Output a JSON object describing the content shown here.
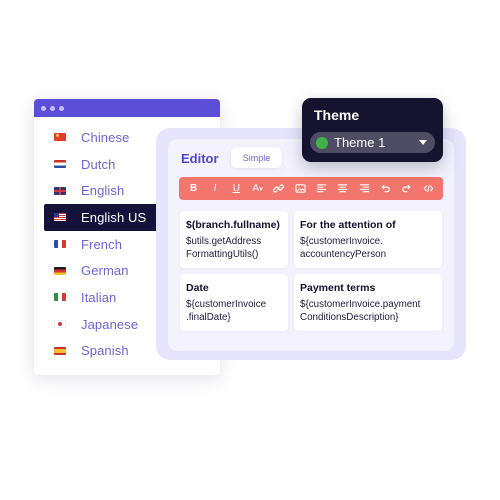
{
  "languages": {
    "items": [
      {
        "label": "Chinese",
        "flag": "flag-china"
      },
      {
        "label": "Dutch",
        "flag": "flag-netherlands"
      },
      {
        "label": "English",
        "flag": "flag-uk"
      },
      {
        "label": "English US",
        "flag": "flag-usa",
        "selected": true
      },
      {
        "label": "French",
        "flag": "flag-france"
      },
      {
        "label": "German",
        "flag": "flag-germany"
      },
      {
        "label": "Italian",
        "flag": "flag-italy"
      },
      {
        "label": "Japanese",
        "flag": "flag-japan"
      },
      {
        "label": "Spanish",
        "flag": "flag-spain"
      }
    ],
    "accent": "#5a4fd6",
    "selected_bg": "#14123a"
  },
  "editor": {
    "title": "Editor",
    "mode_tab": "Simple",
    "toolbar_color": "#f2766e",
    "toolbar": {
      "bold": "B",
      "italic": "I",
      "underline": "U",
      "font_size": "A",
      "font_size_mark": "▾"
    },
    "cells": [
      {
        "title": "$(branch.fullname)",
        "value": "$utils.getAddress FormattingUtils()"
      },
      {
        "title": "For the attention of",
        "value": "${customerInvoice. accountencyPerson"
      },
      {
        "title": "Date",
        "value": "${customerInvoice .finalDate}"
      },
      {
        "title": "Payment terms",
        "value": "${customerInvoice.payment ConditionsDescription}"
      }
    ]
  },
  "theme": {
    "title": "Theme",
    "selected": "Theme 1",
    "dot_color": "#3fb44a"
  }
}
